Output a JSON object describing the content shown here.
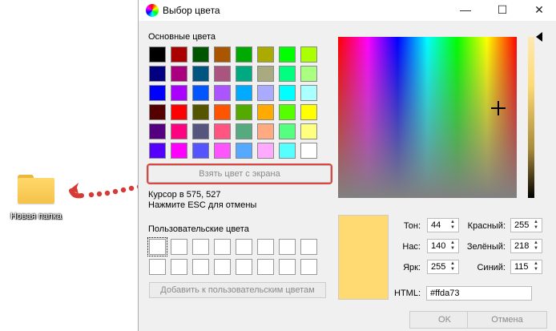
{
  "desktop": {
    "folder_label": "Новая папка"
  },
  "dialog": {
    "title": "Выбор цвета",
    "titlebar_buttons": {
      "minimize": "—",
      "maximize": "☐",
      "close": "✕"
    },
    "basic_colors_label": "Основные цвета",
    "basic_colors": [
      "#000000",
      "#aa0000",
      "#005500",
      "#aa5500",
      "#00aa00",
      "#aaaa00",
      "#00ff00",
      "#aaff00",
      "#000080",
      "#aa0080",
      "#005580",
      "#aa5580",
      "#00aa80",
      "#aaaa80",
      "#00ff80",
      "#aaff80",
      "#0000ff",
      "#aa00ff",
      "#0055ff",
      "#aa55ff",
      "#00aaff",
      "#aaaaff",
      "#00ffff",
      "#aaffff",
      "#550000",
      "#ff0000",
      "#555500",
      "#ff5500",
      "#55aa00",
      "#ffaa00",
      "#55ff00",
      "#ffff00",
      "#550080",
      "#ff0080",
      "#555580",
      "#ff5580",
      "#55aa80",
      "#ffaa80",
      "#55ff80",
      "#ffff80",
      "#5500ff",
      "#ff00ff",
      "#5555ff",
      "#ff55ff",
      "#55aaff",
      "#ffaaff",
      "#55ffff",
      "#ffffff"
    ],
    "pick_screen_button": "Взять цвет с экрана",
    "cursor_info": "Курсор в 575, 527",
    "esc_info": "Нажмите ESC для отмены",
    "custom_colors_label": "Пользовательские цвета",
    "custom_colors_count": 16,
    "add_custom_button": "Добавить к пользовательским цветам",
    "fields": {
      "hue_label": "Тон:",
      "hue": "44",
      "sat_label": "Нас:",
      "sat": "140",
      "val_label": "Ярк:",
      "val": "255",
      "red_label": "Красный:",
      "red": "255",
      "green_label": "Зелёный:",
      "green": "218",
      "blue_label": "Синий:",
      "blue": "115",
      "html_label": "HTML:",
      "html": "#ffda73"
    },
    "current_color": "#ffda73",
    "ok_button": "OK",
    "cancel_button": "Отмена"
  }
}
